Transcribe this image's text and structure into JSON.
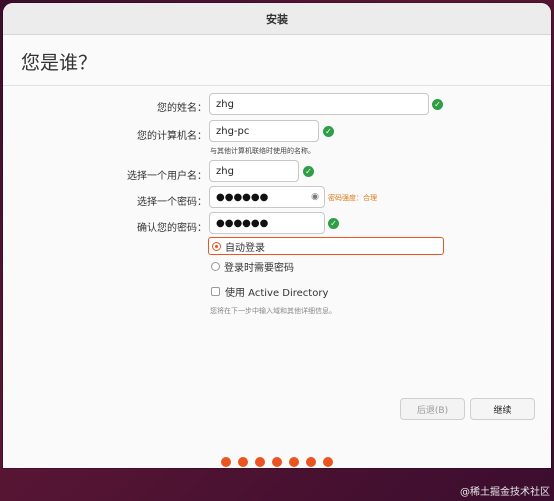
{
  "window": {
    "title": "安装"
  },
  "page": {
    "title": "您是谁？"
  },
  "form": {
    "name_label": "您的姓名：",
    "name_value": "zhg",
    "computer_label": "您的计算机名：",
    "computer_value": "zhg-pc",
    "computer_hint": "与其他计算机联络时使用的名称。",
    "username_label": "选择一个用户名：",
    "username_value": "zhg",
    "password_label": "选择一个密码：",
    "password_value": "●●●●●●",
    "password_strength": "密码强度：合理",
    "confirm_label": "确认您的密码：",
    "confirm_value": "●●●●●●"
  },
  "login": {
    "auto_label": "自动登录",
    "require_label": "登录时需要密码",
    "selected": "auto"
  },
  "ad": {
    "label": "使用 Active Directory",
    "checked": false,
    "hint": "您将在下一步中输入域和其他详细信息。"
  },
  "buttons": {
    "back": "后退(B)",
    "continue": "继续"
  },
  "progress": {
    "total": 7
  },
  "watermark": "@稀土掘金技术社区",
  "colors": {
    "accent": "#e95420",
    "success": "#2e9e47",
    "warning": "#e07b1a"
  }
}
